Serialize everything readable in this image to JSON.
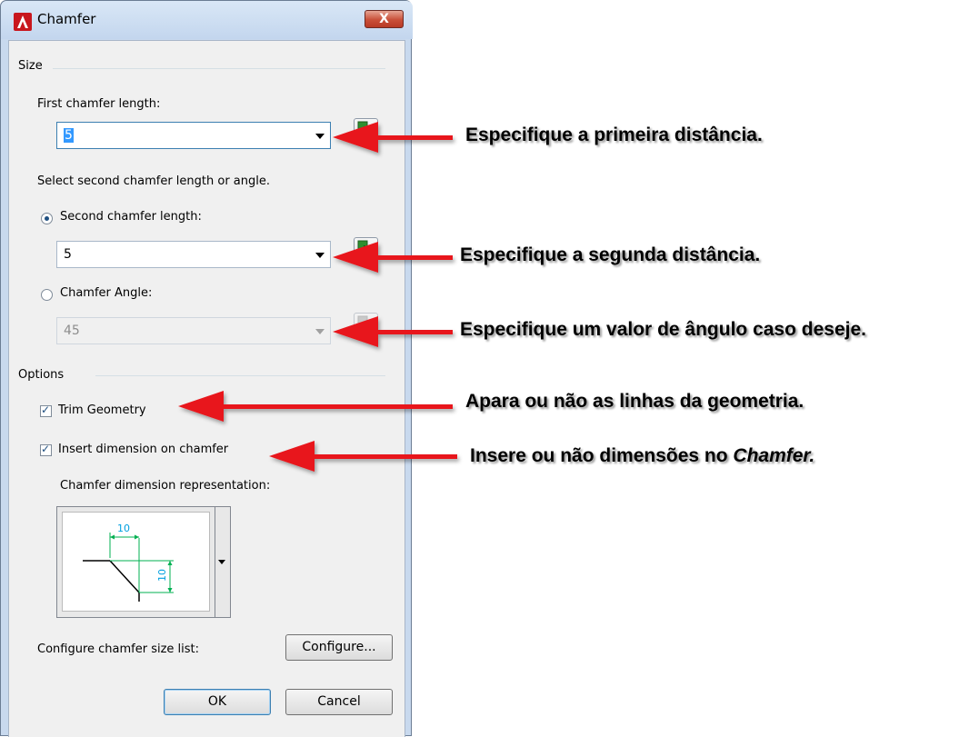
{
  "window": {
    "title": "Chamfer",
    "close_label": "X"
  },
  "size_group": {
    "title": "Size",
    "first_label": "First chamfer length:",
    "first_value": "5",
    "select_label": "Select second chamfer length or angle.",
    "second_label": "Second chamfer length:",
    "second_value": "5",
    "angle_label": "Chamfer Angle:",
    "angle_value": "45"
  },
  "options_group": {
    "title": "Options",
    "trim_label": "Trim Geometry",
    "trim_checked": true,
    "insert_label": "Insert dimension on chamfer",
    "insert_checked": true,
    "representation_label": "Chamfer dimension representation:",
    "preview_dim_h": "10",
    "preview_dim_v": "10"
  },
  "configure": {
    "label": "Configure chamfer size list:",
    "button": "Configure..."
  },
  "buttons": {
    "ok": "OK",
    "cancel": "Cancel"
  },
  "annotations": {
    "first": "Especifique a primeira distância.",
    "second": "Especifique a segunda distância.",
    "angle": "Especifique um valor de ângulo caso deseje.",
    "trim": "Apara ou não as linhas da geometria.",
    "insert_prefix": "Insere ou não dimensões no ",
    "insert_emph": "Chamfer."
  },
  "colors": {
    "arrow": "#e8141a",
    "dimension": "#00b050",
    "dim_text": "#00a0e0",
    "title_bg": "#c8d9ee"
  }
}
